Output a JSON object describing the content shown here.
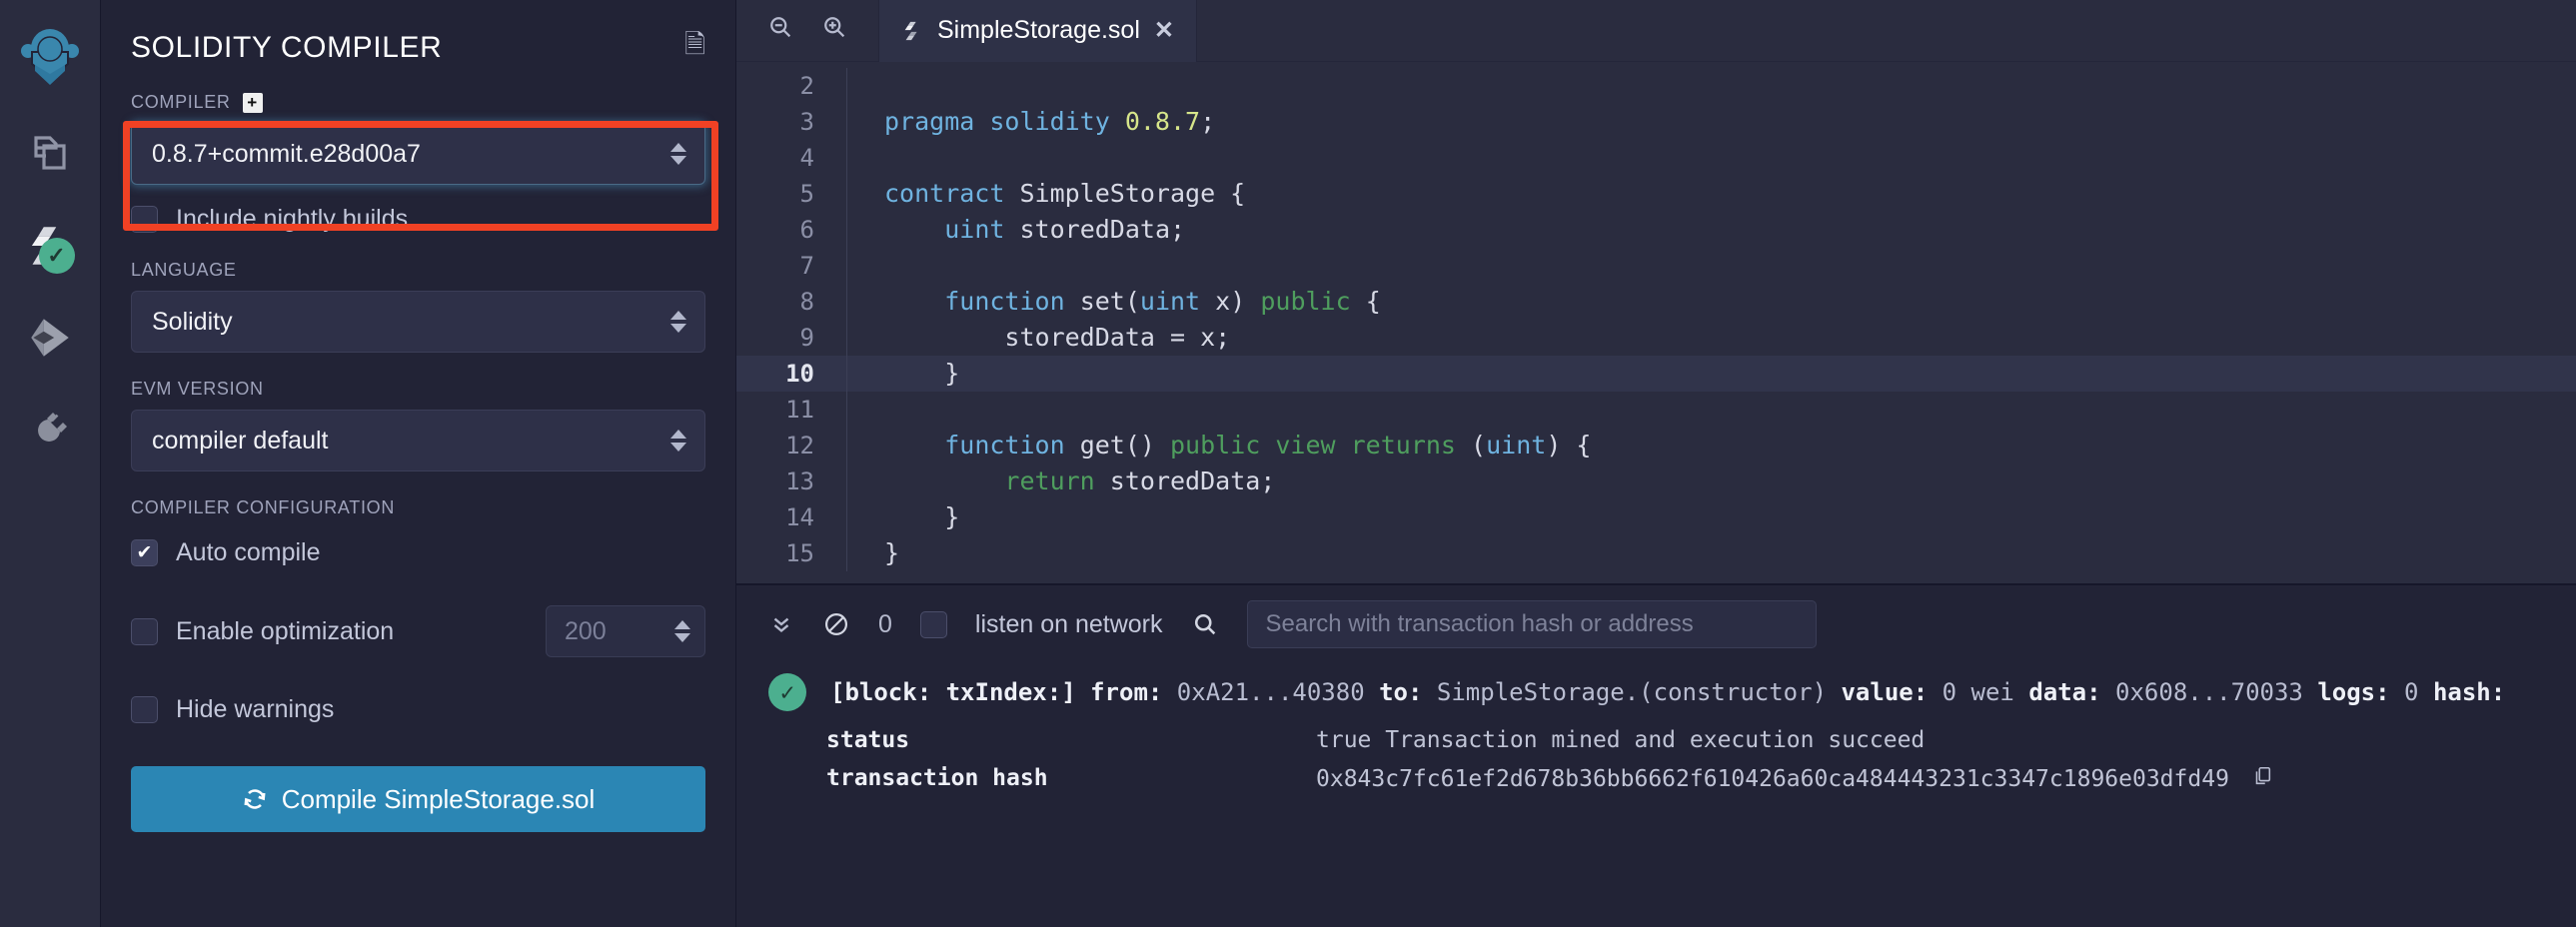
{
  "sidebar": {
    "items": [
      {
        "name": "remix-logo",
        "label": "Remix"
      },
      {
        "name": "file-explorer-icon",
        "label": "File explorers"
      },
      {
        "name": "solidity-compiler-icon",
        "label": "Solidity compiler"
      },
      {
        "name": "deploy-run-icon",
        "label": "Deploy & run transactions"
      },
      {
        "name": "plugin-manager-icon",
        "label": "Plugin manager"
      }
    ]
  },
  "compiler_panel": {
    "title": "SOLIDITY COMPILER",
    "header_icon": "document-icon",
    "compiler_label": "COMPILER",
    "add_custom_icon": "plus-box-icon",
    "compiler_version": "0.8.7+commit.e28d00a7",
    "nightly_label": "Include nightly builds",
    "nightly_checked": false,
    "language_label": "LANGUAGE",
    "language_value": "Solidity",
    "evm_label": "EVM VERSION",
    "evm_value": "compiler default",
    "config_label": "COMPILER CONFIGURATION",
    "auto_compile_label": "Auto compile",
    "auto_compile_checked": true,
    "optimization_label": "Enable optimization",
    "optimization_checked": false,
    "optimization_runs": "200",
    "hide_warnings_label": "Hide warnings",
    "hide_warnings_checked": false,
    "compile_button": "Compile SimpleStorage.sol",
    "compile_button_icon": "refresh-icon",
    "compile_button_color": "#2b86b4",
    "highlight_color": "#f04124"
  },
  "editor": {
    "zoom_out_icon": "zoom-out-icon",
    "zoom_in_icon": "zoom-in-icon",
    "tab": {
      "icon": "solidity-file-icon",
      "label": "SimpleStorage.sol",
      "close_icon": "close-icon"
    },
    "active_line": 10,
    "lines": [
      {
        "n": "2",
        "tokens": []
      },
      {
        "n": "3",
        "tokens": [
          {
            "t": "pragma ",
            "c": "kw"
          },
          {
            "t": "solidity ",
            "c": "kw"
          },
          {
            "t": "0.8.7",
            "c": "num"
          },
          {
            "t": ";",
            "c": "plain"
          }
        ]
      },
      {
        "n": "4",
        "tokens": []
      },
      {
        "n": "5",
        "tokens": [
          {
            "t": "contract ",
            "c": "kw"
          },
          {
            "t": "SimpleStorage {",
            "c": "plain"
          }
        ]
      },
      {
        "n": "6",
        "tokens": [
          {
            "t": "    ",
            "c": "plain"
          },
          {
            "t": "uint",
            "c": "kw"
          },
          {
            "t": " storedData;",
            "c": "plain"
          }
        ]
      },
      {
        "n": "7",
        "tokens": []
      },
      {
        "n": "8",
        "tokens": [
          {
            "t": "    ",
            "c": "plain"
          },
          {
            "t": "function ",
            "c": "kw"
          },
          {
            "t": "set(",
            "c": "plain"
          },
          {
            "t": "uint",
            "c": "kw"
          },
          {
            "t": " x) ",
            "c": "plain"
          },
          {
            "t": "public",
            "c": "kw2"
          },
          {
            "t": " {",
            "c": "plain"
          }
        ]
      },
      {
        "n": "9",
        "tokens": [
          {
            "t": "        storedData = x;",
            "c": "plain"
          }
        ]
      },
      {
        "n": "10",
        "tokens": [
          {
            "t": "    }",
            "c": "plain"
          }
        ]
      },
      {
        "n": "11",
        "tokens": []
      },
      {
        "n": "12",
        "tokens": [
          {
            "t": "    ",
            "c": "plain"
          },
          {
            "t": "function ",
            "c": "kw"
          },
          {
            "t": "get() ",
            "c": "plain"
          },
          {
            "t": "public view returns ",
            "c": "kw2"
          },
          {
            "t": "(",
            "c": "plain"
          },
          {
            "t": "uint",
            "c": "kw"
          },
          {
            "t": ") {",
            "c": "plain"
          }
        ]
      },
      {
        "n": "13",
        "tokens": [
          {
            "t": "        ",
            "c": "plain"
          },
          {
            "t": "return",
            "c": "kw2"
          },
          {
            "t": " storedData;",
            "c": "plain"
          }
        ]
      },
      {
        "n": "14",
        "tokens": [
          {
            "t": "    }",
            "c": "plain"
          }
        ]
      },
      {
        "n": "15",
        "tokens": [
          {
            "t": "}",
            "c": "plain"
          }
        ]
      }
    ]
  },
  "terminal": {
    "collapse_icon": "chevrons-down-icon",
    "clear_icon": "no-entry-icon",
    "count": "0",
    "listen_label": "listen on network",
    "listen_checked": false,
    "search_icon": "search-icon",
    "search_placeholder": "Search with transaction hash or address",
    "tx": {
      "status_icon": "check-circle-icon",
      "header": "[block: txIndex:]  from: 0xA21...40380 to: SimpleStorage.(constructor) value: 0 wei data: 0x608...70033 logs: 0 hash:",
      "header_parts": [
        {
          "t": "[block: txIndex:] ",
          "b": true
        },
        {
          "t": " from: ",
          "b": true
        },
        {
          "t": "0xA21...40380 ",
          "b": false
        },
        {
          "t": "to: ",
          "b": true
        },
        {
          "t": "SimpleStorage.(constructor) ",
          "b": false
        },
        {
          "t": "value: ",
          "b": true
        },
        {
          "t": "0 wei ",
          "b": false
        },
        {
          "t": "data: ",
          "b": true
        },
        {
          "t": "0x608...70033 ",
          "b": false
        },
        {
          "t": "logs: ",
          "b": true
        },
        {
          "t": "0 ",
          "b": false
        },
        {
          "t": "hash:",
          "b": true
        }
      ],
      "rows": [
        {
          "key": "status",
          "value": "true Transaction mined and execution succeed",
          "copy": false
        },
        {
          "key": "transaction hash",
          "value": "0x843c7fc61ef2d678b36bb6662f610426a60ca484443231c3347c1896e03dfd49",
          "copy": true
        }
      ],
      "copy_icon": "copy-icon"
    }
  }
}
